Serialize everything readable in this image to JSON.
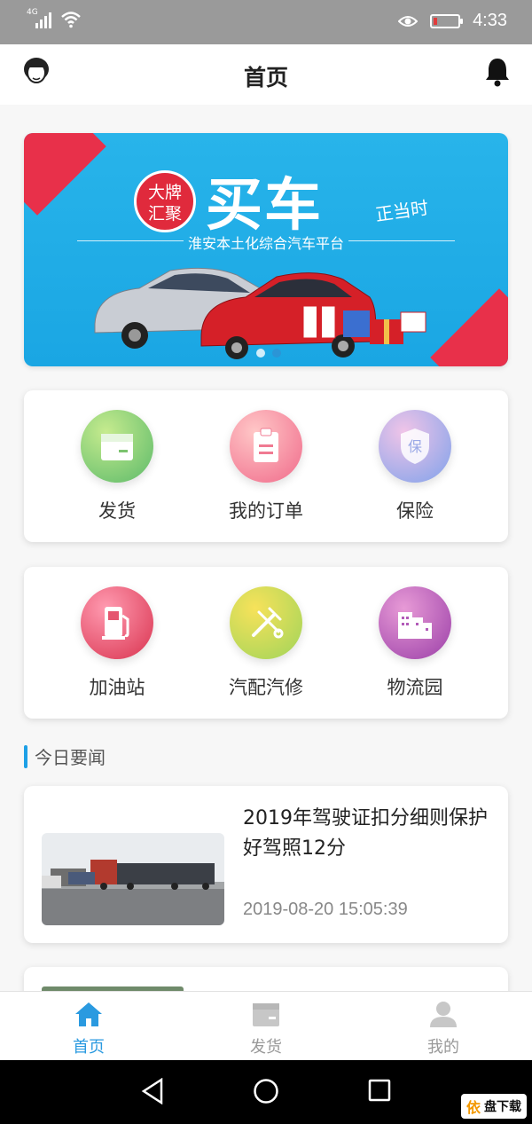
{
  "status": {
    "network": "4G",
    "time": "4:33"
  },
  "header": {
    "title": "首页"
  },
  "banner": {
    "seal_line1": "大牌",
    "seal_line2": "汇聚",
    "headline": "买车",
    "headline_tail": "正当时",
    "subtitle": "淮安本土化综合汽车平台"
  },
  "services_row1": [
    {
      "label": "发货",
      "icon": "box-icon",
      "color": "#6cc26a"
    },
    {
      "label": "我的订单",
      "icon": "order-icon",
      "color": "#f26f8a"
    },
    {
      "label": "保险",
      "icon": "shield-icon",
      "color": "#8aa6e8"
    }
  ],
  "services_row2": [
    {
      "label": "加油站",
      "icon": "gas-pump-icon",
      "color": "#e94b6a"
    },
    {
      "label": "汽配汽修",
      "icon": "wrench-icon",
      "color": "#c6dc4a"
    },
    {
      "label": "物流园",
      "icon": "buildings-icon",
      "color": "#b04fb6"
    }
  ],
  "news_section": {
    "title": "今日要闻"
  },
  "news": [
    {
      "headline": "2019年驾驶证扣分细则保护好驾照12分",
      "date": "2019-08-20 15:05:39"
    }
  ],
  "tabs": [
    {
      "label": "首页",
      "icon": "home-icon",
      "active": true
    },
    {
      "label": "发货",
      "icon": "box-icon",
      "active": false
    },
    {
      "label": "我的",
      "icon": "person-icon",
      "active": false
    }
  ],
  "watermark": {
    "brand": "依",
    "text": "盘下载"
  }
}
